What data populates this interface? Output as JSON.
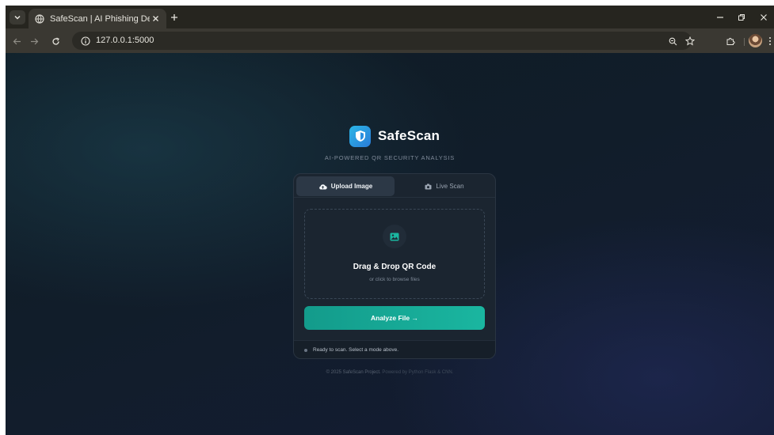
{
  "browser": {
    "tab_title": "SafeScan | AI Phishing Detector",
    "url": "127.0.0.1:5000"
  },
  "app": {
    "name": "SafeScan",
    "tagline": "AI-POWERED QR SECURITY ANALYSIS",
    "tabs": [
      {
        "label": "Upload Image",
        "icon": "cloud-upload-icon",
        "active": true
      },
      {
        "label": "Live Scan",
        "icon": "camera-icon",
        "active": false
      }
    ],
    "dropzone": {
      "icon": "image-icon",
      "title": "Drag & Drop QR Code",
      "subtitle": "or click to browse files"
    },
    "analyze_label": "Analyze File →",
    "status": "Ready to scan. Select a mode above.",
    "footer": {
      "copyright": "© 2025 SafeScan Project.",
      "powered": "Powered by Python Flask & CNN."
    },
    "colors": {
      "accent": "#1ab6a0",
      "logo": "#2a8fe0",
      "card": "#1b2530"
    }
  }
}
